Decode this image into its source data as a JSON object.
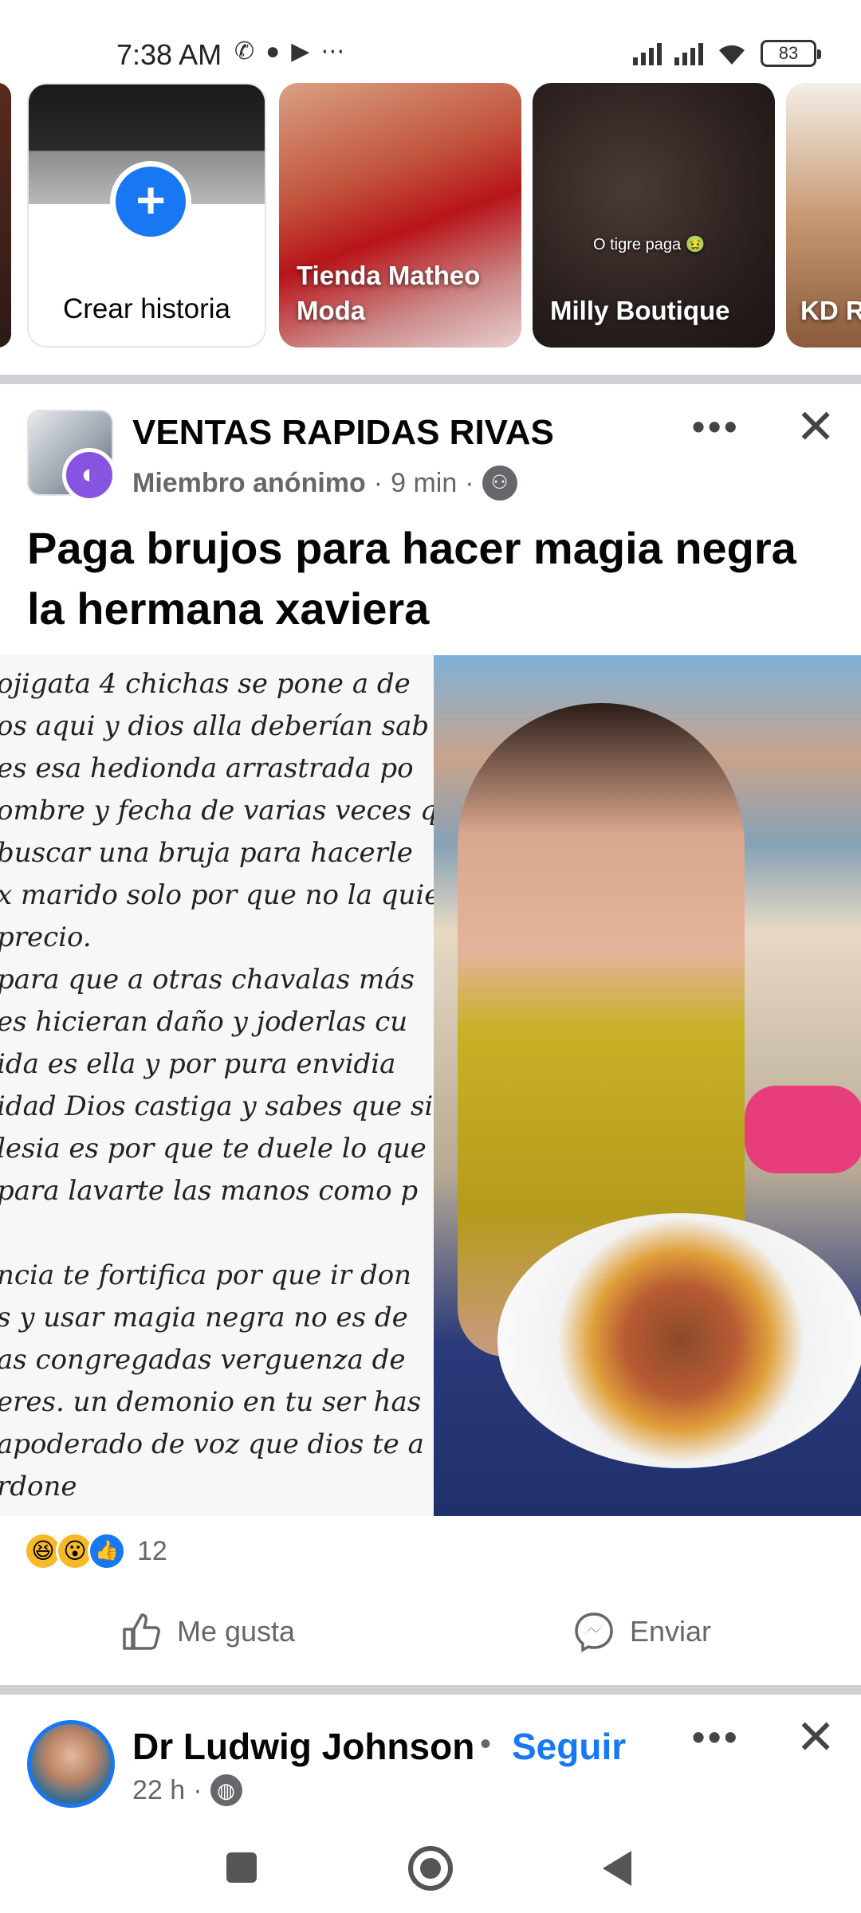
{
  "status_bar": {
    "time": "7:38 AM",
    "app_icons": [
      "whatsapp-icon",
      "messages-icon",
      "youtube-icon",
      "more-dots-icon"
    ],
    "battery": "83"
  },
  "stories": {
    "create_label": "Crear historia",
    "items": [
      {
        "name": "Tienda Matheo Moda"
      },
      {
        "name": "Milly Boutique",
        "overlay_text": "O tigre paga 🤢"
      },
      {
        "name": "KD R"
      }
    ]
  },
  "post": {
    "group_name": "VENTAS RAPIDAS RIVAS",
    "author": "Miembro anónimo",
    "time": "9 min",
    "text": "Paga brujos para hacer magia negra la hermana  xaviera",
    "image_note_lines": [
      "ojigata 4 chichas se pone a de",
      "os aqui y dios alla deberían sab",
      "es esa hedionda arrastrada po",
      "ombre y fecha de varias veces q",
      "buscar una bruja para hacerle",
      "x marido solo por que no la quie",
      "precio.",
      "para que a otras chavalas más",
      "es hicieran daño y joderlas cu",
      "ida es ella y por pura envidia",
      "idad Dios castiga y sabes que si",
      "lesia es por que te duele lo que",
      " para lavarte las manos como p",
      "",
      "ncia te fortifica por que ir don",
      "s y usar magia negra no es de",
      "as congregadas verguenza de",
      " eres. un demonio en tu ser has",
      "apoderado de voz que dios te a",
      "rdone"
    ],
    "reaction_count": "12",
    "like_label": "Me gusta",
    "send_label": "Enviar"
  },
  "next_post": {
    "author": "Dr Ludwig Johnson",
    "follow_label": "Seguir",
    "time": "22 h"
  },
  "colors": {
    "accent": "#1877f2",
    "secondary_text": "#65676b",
    "divider": "#ced0d4"
  }
}
